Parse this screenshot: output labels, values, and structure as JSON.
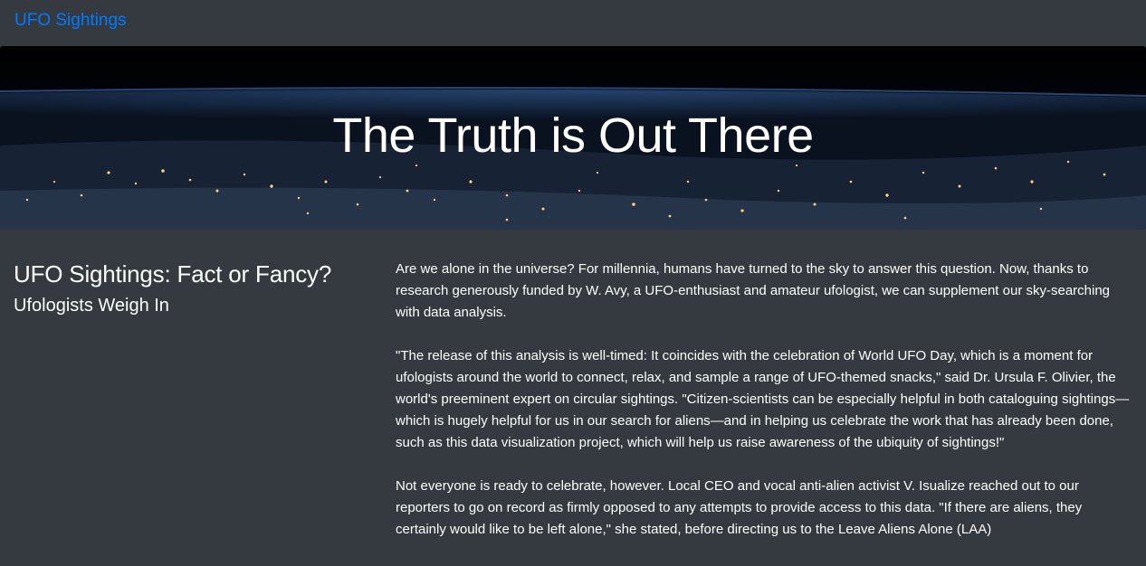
{
  "navbar": {
    "brand": "UFO Sightings"
  },
  "hero": {
    "title": "The Truth is Out There"
  },
  "article": {
    "title": "UFO Sightings: Fact or Fancy?",
    "subtitle": "Ufologists Weigh In",
    "paragraphs": [
      "Are we alone in the universe? For millennia, humans have turned to the sky to answer this question. Now, thanks to research generously funded by W. Avy, a UFO-enthusiast and amateur ufologist, we can supplement our sky-searching with data analysis.",
      "\"The release of this analysis is well-timed: It coincides with the celebration of World UFO Day, which is a moment for ufologists around the world to connect, relax, and sample a range of UFO-themed snacks,\" said Dr. Ursula F. Olivier, the world's preeminent expert on circular sightings. \"Citizen-scientists can be especially helpful in both cataloguing sightings—which is hugely helpful for us in our search for aliens—and in helping us celebrate the work that has already been done, such as this data visualization project, which will help us raise awareness of the ubiquity of sightings!\"",
      "Not everyone is ready to celebrate, however. Local CEO and vocal anti-alien activist V. Isualize reached out to our reporters to go on record as firmly opposed to any attempts to provide access to this data. \"If there are aliens, they certainly would like to be left alone,\" she stated, before directing us to the Leave Aliens Alone (LAA)"
    ]
  },
  "colors": {
    "background": "#343a40",
    "brand": "#007bff",
    "text": "#ffffff"
  }
}
